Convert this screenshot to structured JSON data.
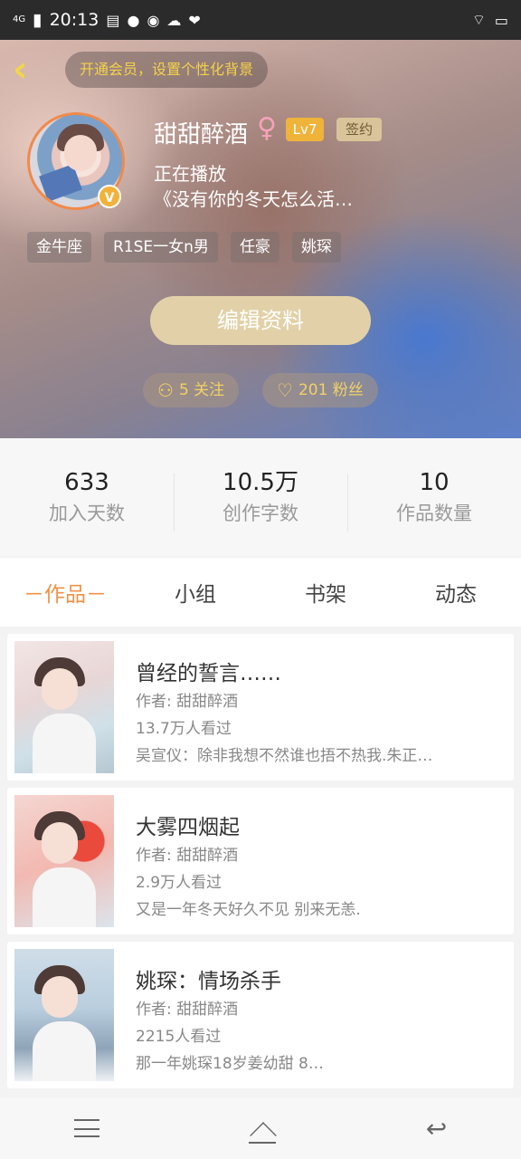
{
  "status_bar": {
    "network": "4G",
    "time": "20:13",
    "battery_text": ""
  },
  "header": {
    "vip_promo": "开通会员，设置个性化背景",
    "username": "甜甜醉酒",
    "gender_icon": "female-icon",
    "level": "Lv7",
    "signed_badge": "签约",
    "playing_label": "正在播放",
    "playing_song": "《没有你的冬天怎么活…",
    "tags": [
      "金牛座",
      "R1SE一女n男",
      "任豪",
      "姚琛"
    ],
    "edit_button": "编辑资料",
    "following": "5 关注",
    "followers": "201 粉丝",
    "colors": {
      "accent_gold": "#f1d165",
      "level_badge": "#f0b33a",
      "avatar_border": "#f08a4b"
    }
  },
  "stats": [
    {
      "value": "633",
      "label": "加入天数"
    },
    {
      "value": "10.5万",
      "label": "创作字数"
    },
    {
      "value": "10",
      "label": "作品数量"
    }
  ],
  "tabs": [
    {
      "label": "－作品－",
      "active": true
    },
    {
      "label": "小组",
      "active": false
    },
    {
      "label": "书架",
      "active": false
    },
    {
      "label": "动态",
      "active": false
    }
  ],
  "works": [
    {
      "title": "曾经的誓言……",
      "author": "作者: 甜甜醉酒",
      "views": "13.7万人看过",
      "desc": "吴宣仪：除非我想不然谁也捂不热我.朱正…"
    },
    {
      "title": "大雾四烟起",
      "author": "作者: 甜甜醉酒",
      "views": "2.9万人看过",
      "desc": "又是一年冬天好久不见 别来无恙."
    },
    {
      "title": "姚琛：情场杀手",
      "author": "作者: 甜甜醉酒",
      "views": "2215人看过",
      "desc": "那一年姚琛18岁姜幼甜 8…"
    }
  ],
  "accent_color": "#f19146"
}
